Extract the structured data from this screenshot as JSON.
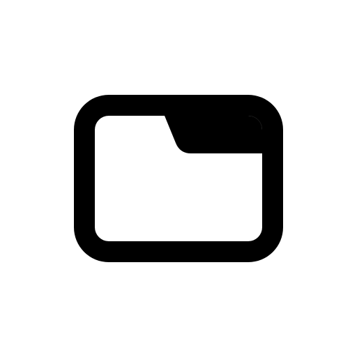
{
  "icon": {
    "name": "folder-tab-icon",
    "color": "#000000",
    "background": "#ffffff"
  }
}
